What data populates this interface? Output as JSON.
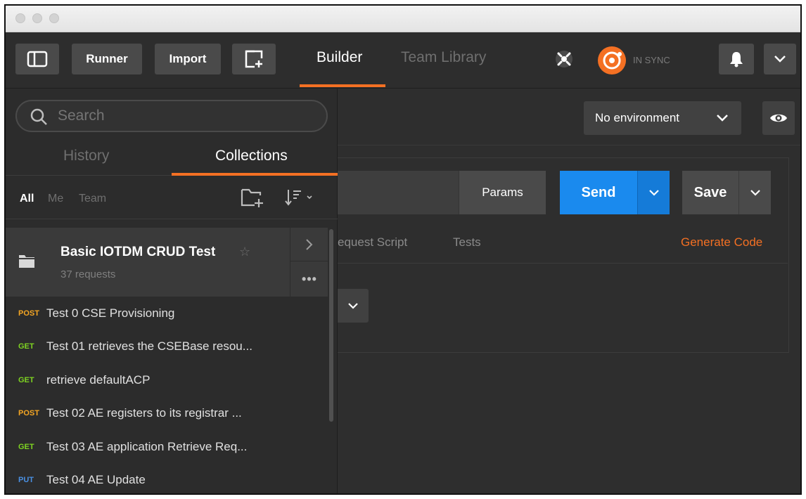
{
  "toolbar": {
    "runner_label": "Runner",
    "import_label": "Import",
    "tabs": [
      {
        "label": "Builder",
        "active": true
      },
      {
        "label": "Team Library",
        "active": false
      }
    ],
    "sync_status": "IN SYNC"
  },
  "colors": {
    "accent": "#f47023",
    "send": "#1a8aee",
    "post": "#f5a623",
    "get": "#7ed321",
    "put": "#4a90e2"
  },
  "sidebar": {
    "search_placeholder": "Search",
    "tabs": [
      {
        "label": "History",
        "active": false
      },
      {
        "label": "Collections",
        "active": true
      }
    ],
    "filters": [
      {
        "label": "All",
        "active": true
      },
      {
        "label": "Me",
        "active": false
      },
      {
        "label": "Team",
        "active": false
      }
    ],
    "collection": {
      "name": "Basic IOTDM CRUD Test",
      "count": "37 requests"
    },
    "requests": [
      {
        "method": "POST",
        "name": "Test 0 CSE Provisioning"
      },
      {
        "method": "GET",
        "name": "Test 01 retrieves the CSEBase resou..."
      },
      {
        "method": "GET",
        "name": "retrieve defaultACP"
      },
      {
        "method": "POST",
        "name": "Test 02 AE registers to its registrar ..."
      },
      {
        "method": "GET",
        "name": "Test 03 AE application Retrieve Req..."
      },
      {
        "method": "PUT",
        "name": "Test 04 AE Update"
      }
    ]
  },
  "main": {
    "environment": "No environment",
    "params_label": "Params",
    "send_label": "Send",
    "save_label": "Save",
    "subtabs": [
      "equest Script",
      "Tests"
    ],
    "generate_code_label": "Generate Code"
  }
}
